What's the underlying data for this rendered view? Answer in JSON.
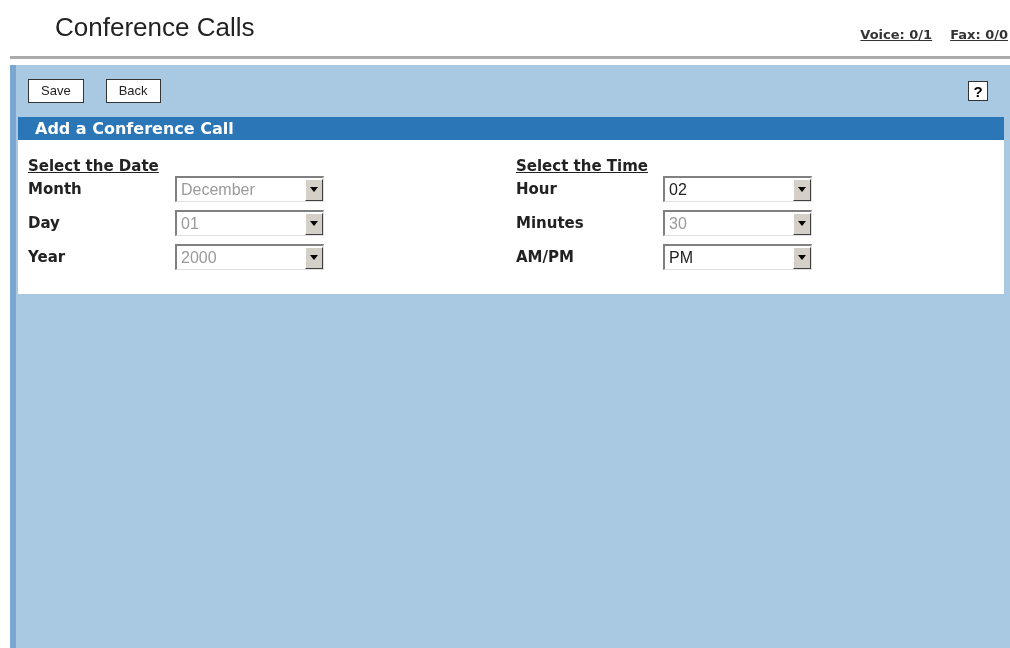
{
  "page": {
    "title": "Conference Calls",
    "counters": [
      "Voice: 0/1",
      "Fax: 0/0"
    ]
  },
  "toolbar": {
    "buttons": [
      "Save",
      "Back"
    ],
    "help": "?"
  },
  "section": {
    "title": "Add a Conference Call"
  },
  "groups": [
    {
      "heading": "Select the Date",
      "fields": [
        {
          "label": "Month",
          "value": "December",
          "disabled": true
        },
        {
          "label": "Day",
          "value": "01",
          "disabled": true
        },
        {
          "label": "Year",
          "value": "2000",
          "disabled": true
        }
      ]
    },
    {
      "heading": "Select the Time",
      "fields": [
        {
          "label": "Hour",
          "value": "02",
          "disabled": false
        },
        {
          "label": "Minutes",
          "value": "30",
          "disabled": true
        },
        {
          "label": "AM/PM",
          "value": "PM",
          "disabled": false
        }
      ]
    }
  ]
}
